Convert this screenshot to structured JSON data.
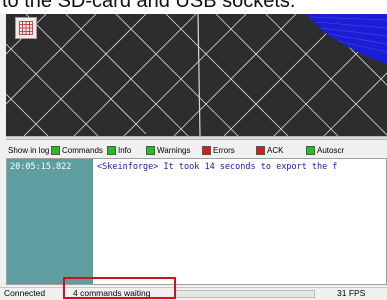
{
  "caption": {
    "text": "to the SD-card and USB sockets."
  },
  "log": {
    "show_in_log_label": "Show in log",
    "filters": [
      {
        "label": "Commands",
        "color": "#22c01f"
      },
      {
        "label": "Info",
        "color": "#22c01f"
      },
      {
        "label": "Warnings",
        "color": "#22c01f"
      },
      {
        "label": "Errors",
        "color": "#d81a1a"
      },
      {
        "label": "ACK",
        "color": "#d81a1a"
      },
      {
        "label": "Autoscr",
        "color": "#22c01f"
      }
    ],
    "entry": {
      "timestamp": "20:05:15.822",
      "message": "<Skeinforge> It took 14 seconds to export the f"
    }
  },
  "status_bar": {
    "connection": "Connected",
    "commands_waiting": "4 commands waiting",
    "fps": "31 FPS",
    "progress_fraction": 0.0
  },
  "colors": {
    "viewport_bg": "#2d2d2d",
    "timestamp_bg": "#5e9ea0",
    "highlight": "#d0121a",
    "model_blue": "#1d1dd6"
  }
}
